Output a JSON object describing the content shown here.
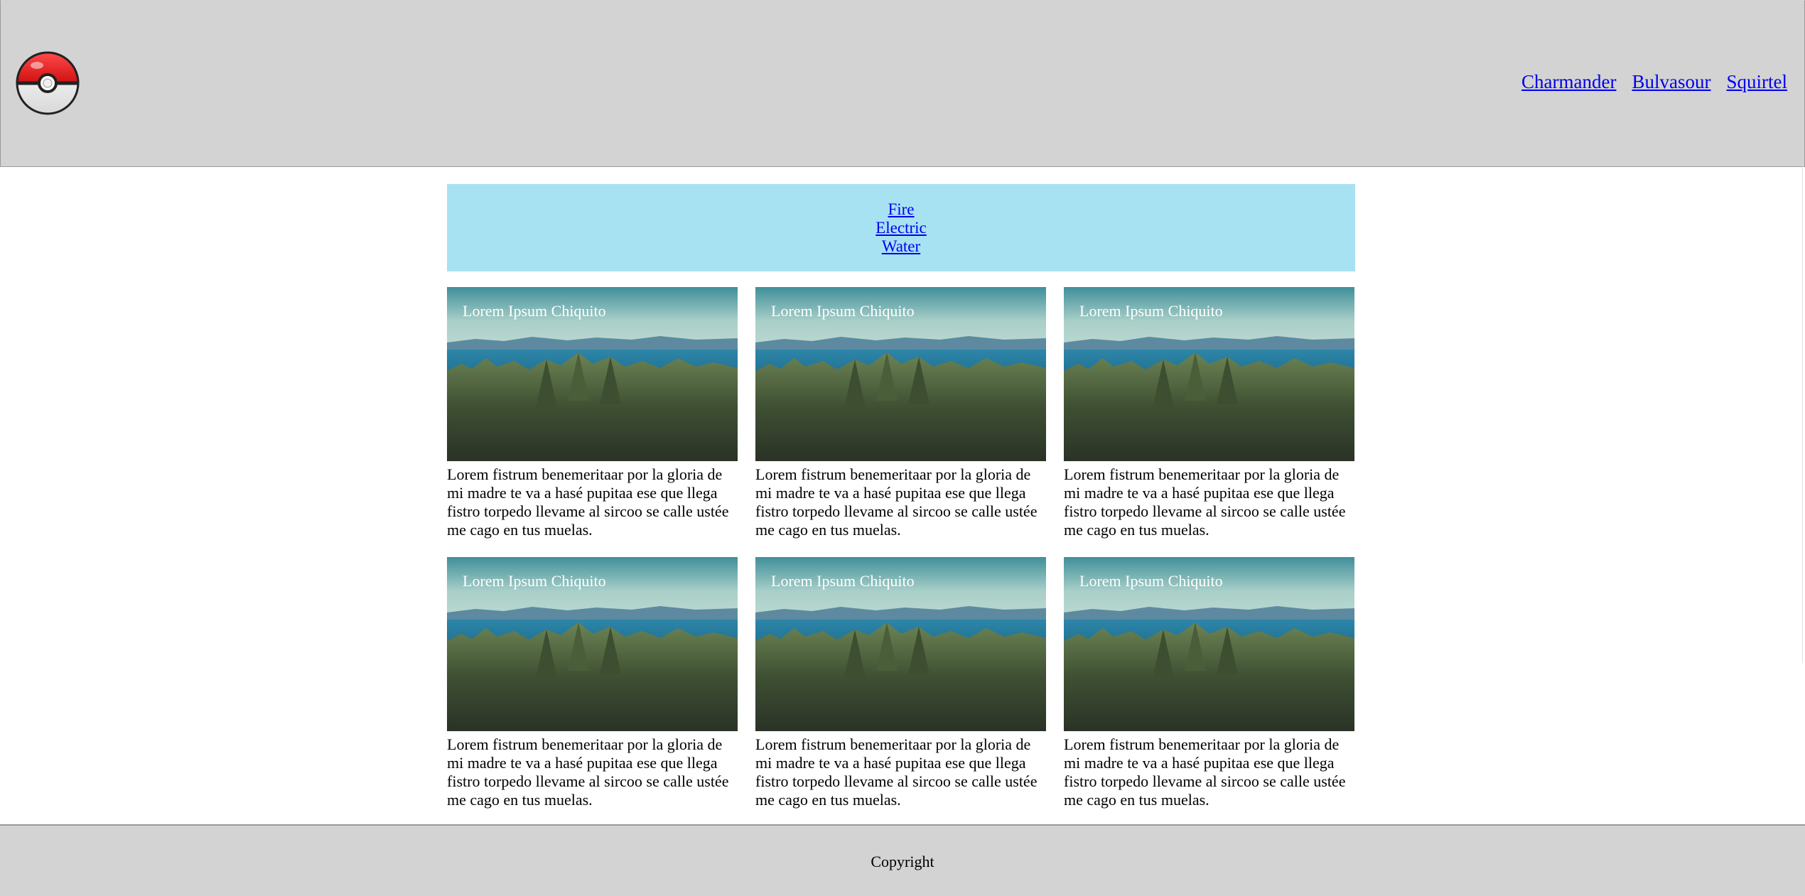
{
  "nav": {
    "links": [
      "Charmander",
      "Bulvasour",
      "Squirtel"
    ]
  },
  "filters": {
    "links": [
      "Fire",
      "Electric",
      "Water"
    ]
  },
  "cards": [
    {
      "title": "Lorem Ipsum Chiquito",
      "text": "Lorem fistrum benemeritaar por la gloria de mi madre te va a hasé pupitaa ese que llega fistro torpedo llevame al sircoo se calle ustée me cago en tus muelas."
    },
    {
      "title": "Lorem Ipsum Chiquito",
      "text": "Lorem fistrum benemeritaar por la gloria de mi madre te va a hasé pupitaa ese que llega fistro torpedo llevame al sircoo se calle ustée me cago en tus muelas."
    },
    {
      "title": "Lorem Ipsum Chiquito",
      "text": "Lorem fistrum benemeritaar por la gloria de mi madre te va a hasé pupitaa ese que llega fistro torpedo llevame al sircoo se calle ustée me cago en tus muelas."
    },
    {
      "title": "Lorem Ipsum Chiquito",
      "text": "Lorem fistrum benemeritaar por la gloria de mi madre te va a hasé pupitaa ese que llega fistro torpedo llevame al sircoo se calle ustée me cago en tus muelas."
    },
    {
      "title": "Lorem Ipsum Chiquito",
      "text": "Lorem fistrum benemeritaar por la gloria de mi madre te va a hasé pupitaa ese que llega fistro torpedo llevame al sircoo se calle ustée me cago en tus muelas."
    },
    {
      "title": "Lorem Ipsum Chiquito",
      "text": "Lorem fistrum benemeritaar por la gloria de mi madre te va a hasé pupitaa ese que llega fistro torpedo llevame al sircoo se calle ustée me cago en tus muelas."
    }
  ],
  "footer": {
    "text": "Copyright"
  },
  "colors": {
    "header_bg": "#d3d3d3",
    "filter_bg": "#a7e2f3",
    "link": "#0000ee"
  },
  "icons": {
    "logo": "pokeball-icon"
  }
}
